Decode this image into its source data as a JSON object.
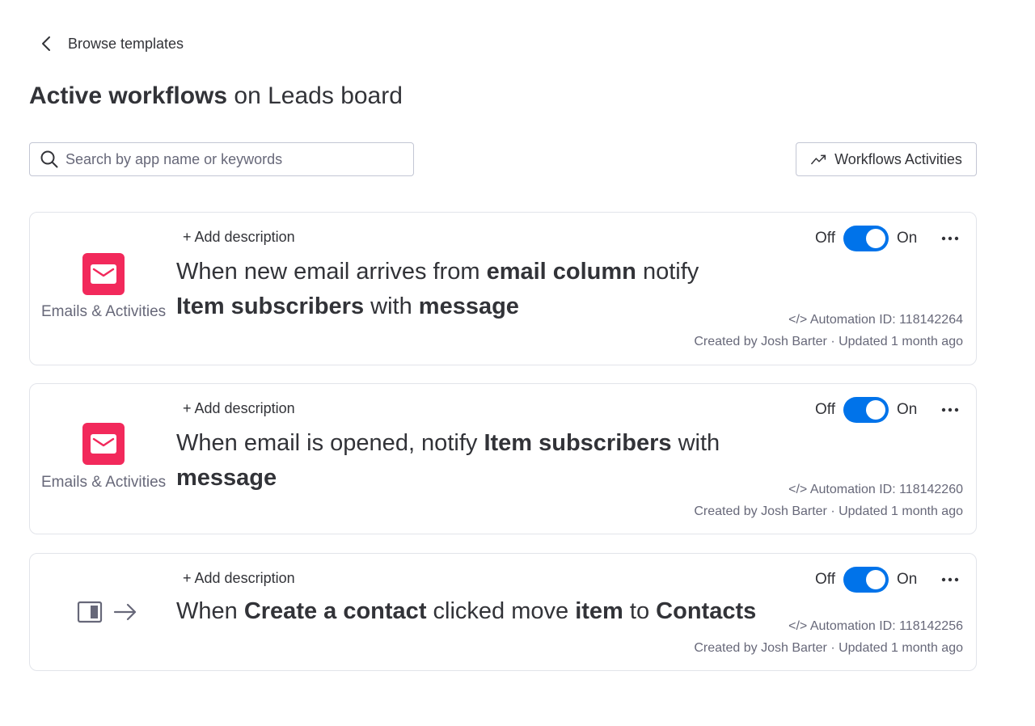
{
  "nav": {
    "back_label": "Browse templates"
  },
  "header": {
    "title_bold": "Active workflows",
    "title_rest": " on Leads board"
  },
  "search": {
    "placeholder": "Search by app name or keywords"
  },
  "toolbar": {
    "activities_label": "Workflows Activities"
  },
  "colors": {
    "accent": "#0073ea",
    "app_icon": "#f2295b"
  },
  "workflows": [
    {
      "app_icon": "mail-icon",
      "app_name": "Emails & Activities",
      "add_description": "+ Add description",
      "recipe": [
        {
          "t": "When new email arrives from ",
          "b": false
        },
        {
          "t": "email column",
          "b": true
        },
        {
          "t": " notify ",
          "b": false
        },
        {
          "t": "Item subscribers",
          "b": true
        },
        {
          "t": " with ",
          "b": false
        },
        {
          "t": "message",
          "b": true
        }
      ],
      "toggle_off_label": "Off",
      "toggle_on_label": "On",
      "enabled": true,
      "automation_id": "</> Automation ID: 118142264",
      "meta": "Created by Josh Barter · Updated 1 month ago"
    },
    {
      "app_icon": "mail-icon",
      "app_name": "Emails & Activities",
      "add_description": "+ Add description",
      "recipe": [
        {
          "t": "When email is opened, notify ",
          "b": false
        },
        {
          "t": "Item subscribers",
          "b": true
        },
        {
          "t": " with ",
          "b": false
        },
        {
          "t": "message",
          "b": true
        }
      ],
      "toggle_off_label": "Off",
      "toggle_on_label": "On",
      "enabled": true,
      "automation_id": "</> Automation ID: 118142260",
      "meta": "Created by Josh Barter · Updated 1 month ago"
    },
    {
      "app_icon": "board-move-icon",
      "app_name": "",
      "add_description": "+ Add description",
      "recipe": [
        {
          "t": "When ",
          "b": false
        },
        {
          "t": "Create a contact",
          "b": true
        },
        {
          "t": " clicked move ",
          "b": false
        },
        {
          "t": "item",
          "b": true
        },
        {
          "t": " to ",
          "b": false
        },
        {
          "t": "Contacts",
          "b": true
        }
      ],
      "toggle_off_label": "Off",
      "toggle_on_label": "On",
      "enabled": true,
      "automation_id": "</> Automation ID: 118142256",
      "meta": "Created by Josh Barter · Updated 1 month ago"
    }
  ]
}
